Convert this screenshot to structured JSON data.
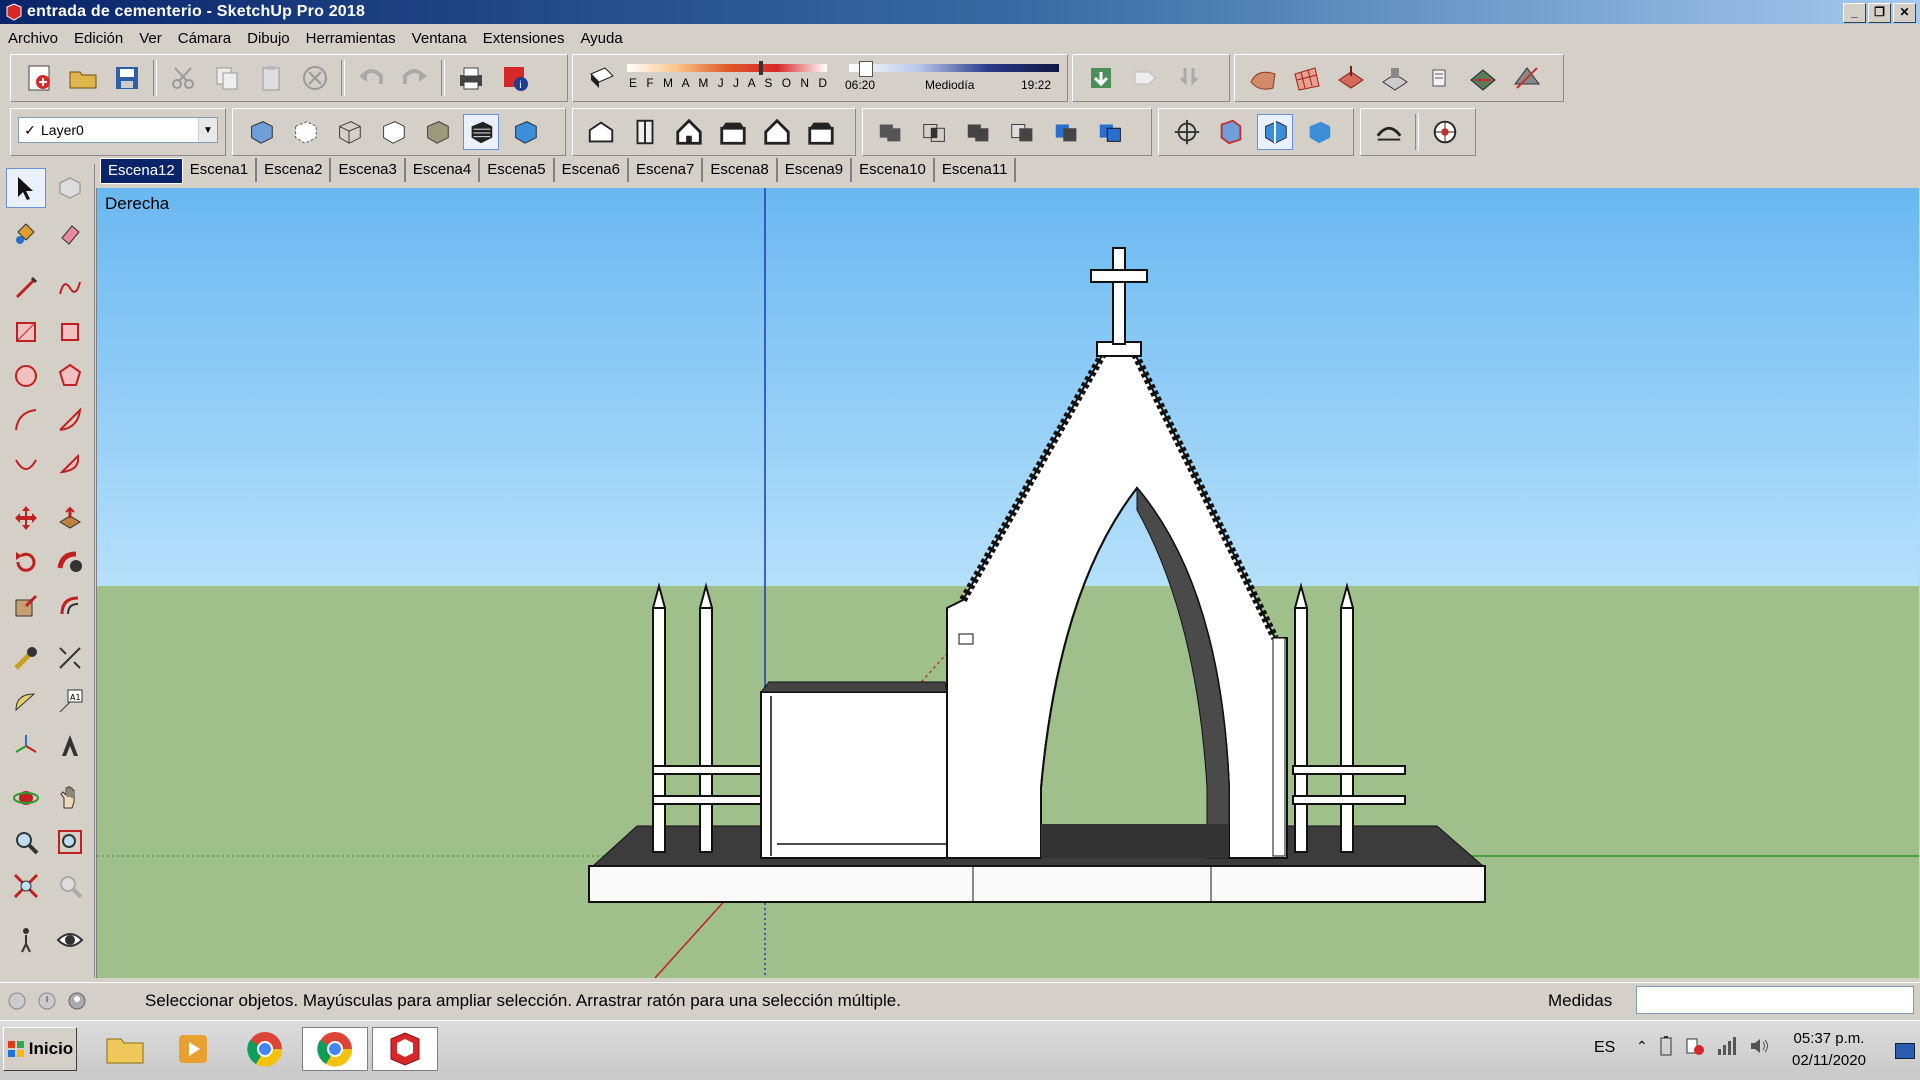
{
  "window": {
    "title": "entrada de cementerio - SketchUp Pro 2018",
    "controls": [
      "minimize-icon",
      "restore-icon",
      "close-icon"
    ]
  },
  "menu": [
    "Archivo",
    "Edición",
    "Ver",
    "Cámara",
    "Dibujo",
    "Herramientas",
    "Ventana",
    "Extensiones",
    "Ayuda"
  ],
  "shadows": {
    "months": "E F M A M J J A S O N D",
    "time_start": "06:20",
    "time_mid": "Mediodía",
    "time_end": "19:22"
  },
  "layer": {
    "selected": "Layer0"
  },
  "scenes": {
    "tabs": [
      "Escena12",
      "Escena1",
      "Escena2",
      "Escena3",
      "Escena4",
      "Escena5",
      "Escena6",
      "Escena7",
      "Escena8",
      "Escena9",
      "Escena10",
      "Escena11"
    ],
    "active": "Escena12"
  },
  "viewport": {
    "view_label": "Derecha",
    "sky_color": "#8ecdf7",
    "ground_color": "#9fbf8b"
  },
  "status": {
    "text": "Seleccionar objetos. Mayúsculas para ampliar selección. Arrastrar ratón para una selección múltiple.",
    "measure_label": "Medidas",
    "measure_value": ""
  },
  "taskbar": {
    "start_label": "Inicio",
    "language": "ES",
    "time": "05:37 p.m.",
    "date": "02/11/2020"
  }
}
